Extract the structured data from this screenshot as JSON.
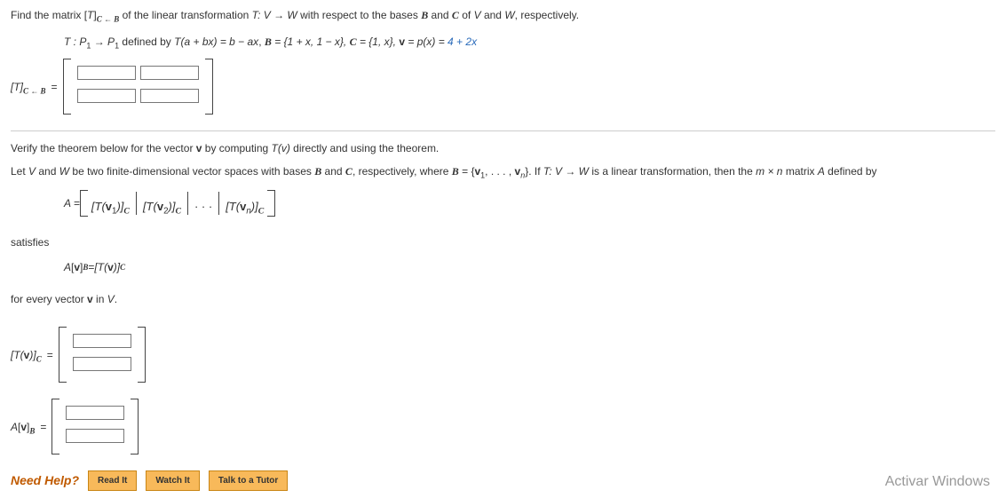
{
  "line1_pre": "Find the matrix [",
  "line1_T": "T",
  "line1_mid": "]",
  "line1_sub": "C ← B",
  "line1_post": " of the linear transformation ",
  "line1_map": "T: V → W",
  "line1_post2": " with respect to the bases ",
  "B": "B",
  "line1_and": " and ",
  "C": "C",
  "line1_of": " of ",
  "V": "V",
  "line1_and2": " and ",
  "W": "W",
  "line1_end": ", respectively.",
  "defT_pre": "T : ",
  "defT_P1a": "P",
  "defT_sub1a": "1",
  "defT_arrow": " → ",
  "defT_P1b": "P",
  "defT_sub1b": "1",
  "defT_defby": " defined by ",
  "defT_rule": "T(a + bx) = b − ax",
  "defT_Bset": ", ",
  "defT_Bsym": "B",
  "defT_Bval": " = {1 + x, 1 − x}, ",
  "defT_Csym": "C",
  "defT_Cval": " = {1, x}, ",
  "defT_veq": "v",
  "defT_vassign": " = p(x) = ",
  "defT_vval": "4 + 2x",
  "matlabel_T": "[T]",
  "matlabel_sub": "C ← B",
  "eq": " =",
  "verify_line": "Verify the theorem below for the vector ",
  "verify_v": "v",
  "verify_line2": " by computing ",
  "verify_Tv": "T(v)",
  "verify_line3": " directly and using the theorem.",
  "thm_pre": "Let ",
  "thm_V": "V",
  "thm_and": " and ",
  "thm_W": "W",
  "thm_mid1": " be two finite-dimensional vector spaces with bases ",
  "thm_B": "B",
  "thm_and2": " and ",
  "thm_C": "C",
  "thm_mid2": ", respectively, where ",
  "thm_B2": "B",
  "thm_set": " = {",
  "thm_v": "v",
  "thm_sub1": "1",
  "thm_dots": ", . . . , ",
  "thm_v2": "v",
  "thm_subn": "n",
  "thm_close": "}. If ",
  "thm_map": "T: V → W",
  "thm_islinear": " is a linear transformation, then the ",
  "thm_mxn": "m × n",
  "thm_matA": " matrix ",
  "thm_A": "A",
  "thm_defby": " defined by",
  "Aeq_pre": "A = ",
  "Aeq_col1_pre": "[T(",
  "Aeq_col1_v": "v",
  "Aeq_col1_sub": "1",
  "Aeq_col1_post": ")]",
  "Aeq_col1_C": "C",
  "Aeq_col2_pre": "[T(",
  "Aeq_col2_v": "v",
  "Aeq_col2_sub": "2",
  "Aeq_col2_post": ")]",
  "Aeq_col2_C": "C",
  "Aeq_dots": " · · · ",
  "Aeq_coln_pre": "[T(",
  "Aeq_coln_v": "v",
  "Aeq_coln_sub": "n",
  "Aeq_coln_post": ")]",
  "Aeq_coln_C": "C",
  "satisfies": "satisfies",
  "eq2_lhs_A": "A",
  "eq2_lhs_bracket": "[",
  "eq2_lhs_v": "v",
  "eq2_lhs_close": "]",
  "eq2_lhs_sub": "B",
  "eq2_eq": " = ",
  "eq2_rhs_pre": "[T(",
  "eq2_rhs_v": "v",
  "eq2_rhs_post": ")]",
  "eq2_rhs_sub": "C",
  "forevery_pre": "for every vector ",
  "forevery_v": "v",
  "forevery_in": " in ",
  "forevery_V": "V",
  "forevery_dot": ".",
  "Tvc_label_pre": "[T(",
  "Tvc_label_v": "v",
  "Tvc_label_post": ")]",
  "Tvc_label_sub": "C",
  "Avb_label_A": "A",
  "Avb_label_open": "[",
  "Avb_label_v": "v",
  "Avb_label_close": "]",
  "Avb_label_sub": "B",
  "needhelp": "Need Help?",
  "readit": "Read It",
  "watchit": "Watch It",
  "talkto": "Talk to a Tutor",
  "watermark": "Activar Windows"
}
